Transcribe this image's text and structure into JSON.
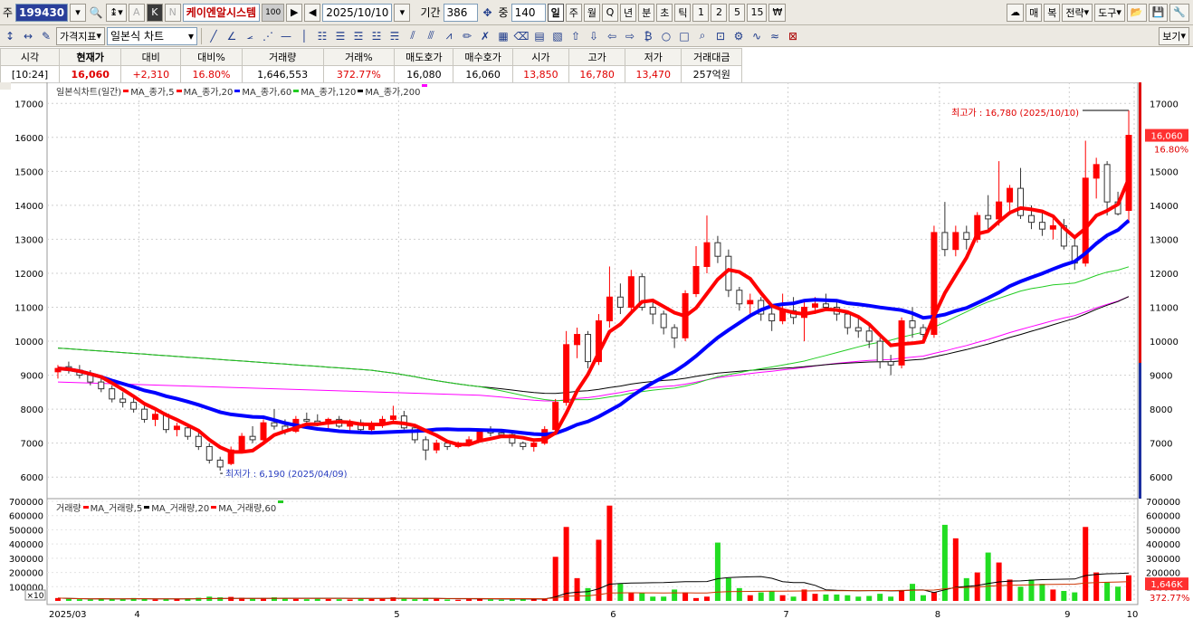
{
  "toolbar1": {
    "mode": "주",
    "code": "199430",
    "stock_name": "케이엔알시스템",
    "badge": "100",
    "date": "2025/10/10",
    "period_label": "기간",
    "period_value": "386",
    "count_label": "중",
    "count_value": "140",
    "intervals": [
      "일",
      "주",
      "월",
      "Q",
      "년",
      "분",
      "초",
      "틱",
      "1",
      "2",
      "5",
      "15"
    ],
    "selected_interval": "일",
    "right_buttons": [
      "매",
      "복",
      "전략",
      "도구"
    ]
  },
  "toolbar2": {
    "price_indicator": "가격지표",
    "chart_type": "일본식 차트",
    "view_button": "보기"
  },
  "quote": {
    "headers": [
      "시각",
      "현재가",
      "대비",
      "대비%",
      "거래량",
      "거래%",
      "매도호가",
      "매수호가",
      "시가",
      "고가",
      "저가",
      "거래대금"
    ],
    "values": [
      "[10:24]",
      "16,060",
      "+2,310",
      "16.80%",
      "1,646,553",
      "372.77%",
      "16,080",
      "16,060",
      "13,850",
      "16,780",
      "13,470",
      "257억원"
    ]
  },
  "legend": {
    "title": "일본식차트(일간)",
    "items": [
      "MA_종가,5",
      "MA_종가,20",
      "MA_종가,60",
      "MA_종가,120",
      "MA_종가,200"
    ],
    "colors": [
      "#ff0000",
      "#ff0000",
      "#0000ff",
      "#22cc22",
      "#ff00ff"
    ]
  },
  "volume_legend": {
    "title": "거래량",
    "items": [
      "MA_거래량,5",
      "MA_거래량,20",
      "MA_거래량,60"
    ],
    "colors": [
      "#ff0000",
      "#000000",
      "#ff0000"
    ]
  },
  "annotations": {
    "high": "최고가 : 16,780 (2025/10/10)",
    "low": "최저가 : 6,190 (2025/04/09)",
    "price_tag": "16,060",
    "price_pct": "16.80%",
    "vol_tag": "1,646K",
    "vol_pct": "372.77%",
    "vol_unit": "×10"
  },
  "chart_data": {
    "type": "candlestick",
    "x_labels": [
      "2025/03",
      "4",
      "5",
      "6",
      "7",
      "8",
      "9",
      "10"
    ],
    "price_ticks": [
      6000,
      7000,
      8000,
      9000,
      10000,
      11000,
      12000,
      13000,
      14000,
      15000,
      16000,
      17000
    ],
    "volume_ticks": [
      100000,
      200000,
      300000,
      400000,
      500000,
      600000,
      700000
    ],
    "price_range": [
      5500,
      17300
    ],
    "volume_range": [
      0,
      700000
    ],
    "candles_ohlc": [
      [
        9100,
        9300,
        8900,
        9200
      ],
      [
        9250,
        9400,
        9050,
        9150
      ],
      [
        9150,
        9300,
        8900,
        9000
      ],
      [
        9000,
        9150,
        8700,
        8800
      ],
      [
        8800,
        8950,
        8500,
        8600
      ],
      [
        8600,
        8700,
        8200,
        8300
      ],
      [
        8300,
        8500,
        8050,
        8200
      ],
      [
        8200,
        8350,
        7900,
        8000
      ],
      [
        8000,
        8100,
        7600,
        7700
      ],
      [
        7700,
        7950,
        7500,
        7850
      ],
      [
        7850,
        7900,
        7300,
        7400
      ],
      [
        7400,
        7600,
        7200,
        7500
      ],
      [
        7450,
        7550,
        7100,
        7200
      ],
      [
        7200,
        7300,
        6800,
        6900
      ],
      [
        6900,
        7000,
        6400,
        6500
      ],
      [
        6500,
        6600,
        6190,
        6300
      ],
      [
        6400,
        6900,
        6350,
        6800
      ],
      [
        6800,
        7300,
        6750,
        7200
      ],
      [
        7200,
        7500,
        7000,
        7100
      ],
      [
        7100,
        7700,
        7050,
        7600
      ],
      [
        7600,
        8000,
        7400,
        7500
      ],
      [
        7500,
        7700,
        7250,
        7350
      ],
      [
        7350,
        7800,
        7300,
        7700
      ],
      [
        7700,
        7900,
        7500,
        7650
      ],
      [
        7650,
        7850,
        7500,
        7600
      ],
      [
        7600,
        7750,
        7400,
        7700
      ],
      [
        7700,
        7800,
        7450,
        7500
      ],
      [
        7500,
        7700,
        7300,
        7600
      ],
      [
        7600,
        7700,
        7350,
        7400
      ],
      [
        7400,
        7650,
        7300,
        7550
      ],
      [
        7550,
        7800,
        7450,
        7700
      ],
      [
        7700,
        8100,
        7600,
        7800
      ],
      [
        7800,
        7950,
        7400,
        7450
      ],
      [
        7450,
        7500,
        7000,
        7100
      ],
      [
        7100,
        7200,
        6500,
        6800
      ],
      [
        6800,
        7100,
        6700,
        7000
      ],
      [
        7000,
        7100,
        6800,
        6900
      ],
      [
        6900,
        7050,
        6850,
        7000
      ],
      [
        7000,
        7200,
        6900,
        7100
      ],
      [
        7100,
        7400,
        7050,
        7350
      ],
      [
        7350,
        7500,
        7200,
        7300
      ],
      [
        7300,
        7400,
        7150,
        7250
      ],
      [
        7250,
        7300,
        6900,
        7000
      ],
      [
        7000,
        7050,
        6800,
        6900
      ],
      [
        6900,
        7050,
        6750,
        7000
      ],
      [
        7000,
        7500,
        6950,
        7400
      ],
      [
        7400,
        8300,
        7350,
        8200
      ],
      [
        8200,
        10300,
        8100,
        9900
      ],
      [
        9900,
        10400,
        9500,
        10200
      ],
      [
        10200,
        10300,
        9200,
        9400
      ],
      [
        9400,
        10800,
        9300,
        10600
      ],
      [
        10600,
        12200,
        10400,
        11300
      ],
      [
        11300,
        11700,
        10800,
        11000
      ],
      [
        11000,
        12100,
        10900,
        11900
      ],
      [
        11900,
        12000,
        10900,
        11000
      ],
      [
        11000,
        11200,
        10500,
        10800
      ],
      [
        10800,
        10900,
        10200,
        10400
      ],
      [
        10400,
        10500,
        9800,
        10100
      ],
      [
        10100,
        11500,
        10000,
        11400
      ],
      [
        11400,
        12800,
        11300,
        12200
      ],
      [
        12200,
        13700,
        12000,
        12900
      ],
      [
        12900,
        13100,
        12300,
        12500
      ],
      [
        12500,
        12700,
        11300,
        11500
      ],
      [
        11500,
        11600,
        10900,
        11100
      ],
      [
        11100,
        11400,
        10700,
        11200
      ],
      [
        11200,
        11300,
        10600,
        10800
      ],
      [
        10800,
        11000,
        10300,
        10600
      ],
      [
        10600,
        11400,
        10500,
        10900
      ],
      [
        10900,
        11300,
        10500,
        10700
      ],
      [
        10700,
        11200,
        10000,
        11000
      ],
      [
        11000,
        11300,
        10800,
        11100
      ],
      [
        11100,
        11400,
        10900,
        11000
      ],
      [
        11000,
        11200,
        10600,
        10800
      ],
      [
        10800,
        10900,
        10200,
        10400
      ],
      [
        10400,
        10700,
        10100,
        10300
      ],
      [
        10300,
        10500,
        9800,
        10000
      ],
      [
        10000,
        10100,
        9200,
        9400
      ],
      [
        9400,
        9600,
        9000,
        9300
      ],
      [
        9300,
        10700,
        9200,
        10600
      ],
      [
        10600,
        11000,
        10100,
        10400
      ],
      [
        10400,
        10500,
        10000,
        10200
      ],
      [
        10200,
        13400,
        10100,
        13200
      ],
      [
        13200,
        14100,
        12500,
        12700
      ],
      [
        12700,
        13400,
        12500,
        13200
      ],
      [
        13200,
        13400,
        12700,
        13000
      ],
      [
        13000,
        13800,
        12900,
        13700
      ],
      [
        13700,
        14300,
        13200,
        13600
      ],
      [
        13600,
        15300,
        13400,
        14100
      ],
      [
        14100,
        14600,
        13800,
        14500
      ],
      [
        14500,
        15100,
        13600,
        13700
      ],
      [
        13700,
        14000,
        13300,
        13500
      ],
      [
        13500,
        13800,
        13100,
        13300
      ],
      [
        13300,
        13700,
        13000,
        13400
      ],
      [
        13400,
        13600,
        12700,
        12800
      ],
      [
        12800,
        13000,
        12100,
        12300
      ],
      [
        12300,
        15900,
        12200,
        14800
      ],
      [
        14800,
        15400,
        14200,
        15200
      ],
      [
        15200,
        15300,
        13700,
        14100
      ],
      [
        14100,
        14400,
        13700,
        13750
      ],
      [
        13850,
        16780,
        13470,
        16060
      ]
    ],
    "volume": [
      20000,
      15000,
      12000,
      10000,
      18000,
      14000,
      12000,
      20000,
      16000,
      10000,
      12000,
      15000,
      18000,
      22000,
      30000,
      25000,
      28000,
      22000,
      18000,
      20000,
      25000,
      16000,
      14000,
      12000,
      15000,
      13000,
      12000,
      10000,
      15000,
      14000,
      18000,
      25000,
      16000,
      12000,
      20000,
      15000,
      10000,
      8000,
      12000,
      14000,
      10000,
      8000,
      9000,
      10000,
      12000,
      15000,
      310000,
      520000,
      160000,
      90000,
      430000,
      670000,
      120000,
      60000,
      55000,
      30000,
      30000,
      80000,
      60000,
      20000,
      30000,
      410000,
      160000,
      90000,
      40000,
      60000,
      70000,
      40000,
      30000,
      80000,
      50000,
      45000,
      45000,
      40000,
      30000,
      35000,
      50000,
      30000,
      70000,
      120000,
      40000,
      60000,
      535000,
      440000,
      160000,
      200000,
      340000,
      270000,
      150000,
      100000,
      150000,
      120000,
      80000,
      70000,
      60000,
      520000,
      200000,
      130000,
      100000,
      180000
    ]
  }
}
